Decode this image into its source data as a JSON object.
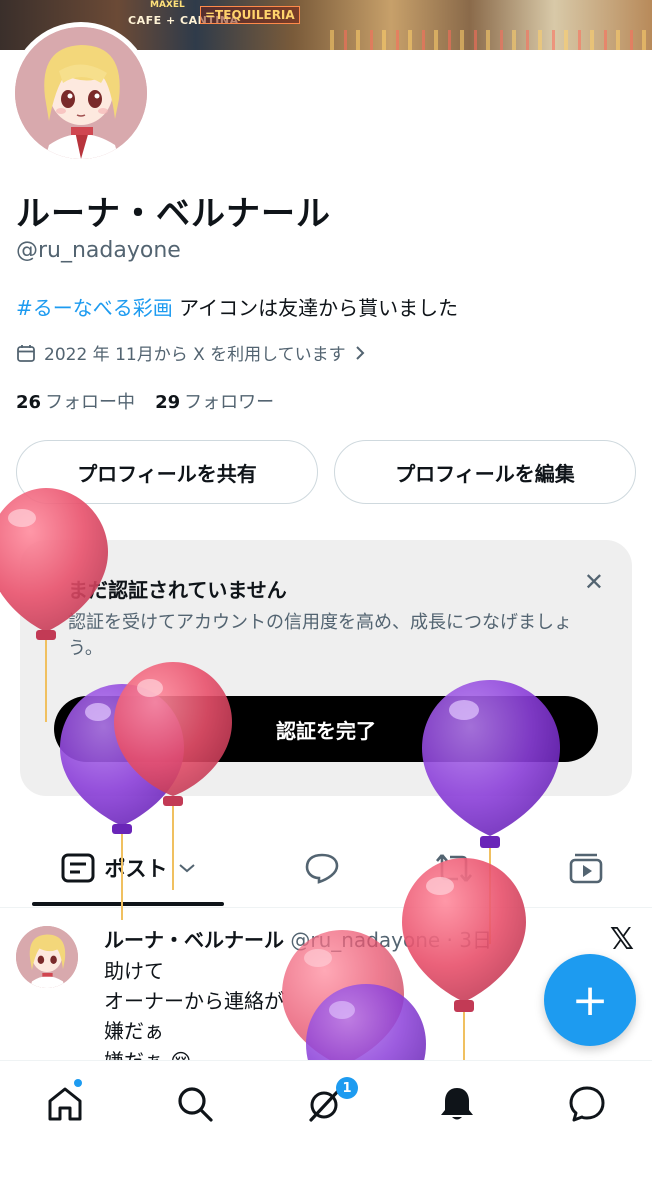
{
  "banner": {
    "sign_left": "CAFE + CANTINA",
    "sign_right": "=TEQUILERIA",
    "sign_top": "MAXEL"
  },
  "profile": {
    "name": "ルーナ・ベルナール",
    "handle": "@ru_nadayone",
    "bio_tag": "#るーなべる彩画",
    "bio_text": " アイコンは友達から貰いました",
    "joined": "2022 年 11月から X を利用しています",
    "following_count": "26",
    "following_label": "フォロー中",
    "followers_count": "29",
    "followers_label": "フォロワー"
  },
  "buttons": {
    "share": "プロフィールを共有",
    "edit": "プロフィールを編集"
  },
  "verify": {
    "title": "まだ認証されていません",
    "desc": "認証を受けてアカウントの信用度を高め、成長につなげましょう。",
    "cta": "認証を完了",
    "close": "✕"
  },
  "tabs": {
    "posts": "ポスト"
  },
  "post": {
    "name": "ルーナ・ベルナール",
    "handle_time": "@ru_nadayone · 3日",
    "lines": [
      "助けて",
      "オーナーから連絡が",
      "嫌だぁ",
      "嫌だぁ 😢"
    ],
    "source_logo": "𝕏"
  },
  "fab": {
    "label": "+"
  },
  "nav": {
    "messages_badge": "1"
  },
  "icons": [
    "calendar-icon",
    "chevron-right-icon",
    "close-icon",
    "posts-tab-icon",
    "chevron-down-icon",
    "reply-icon",
    "repost-icon",
    "media-icon",
    "home-icon",
    "search-icon",
    "grok-icon",
    "bell-icon",
    "chat-icon",
    "plus-icon",
    "x-logo-icon"
  ],
  "colors": {
    "accent": "#1d9bf0",
    "text": "#0f1419",
    "muted": "#536471",
    "balloon_red": "#e8506b",
    "balloon_purple": "#8b3fd9"
  }
}
